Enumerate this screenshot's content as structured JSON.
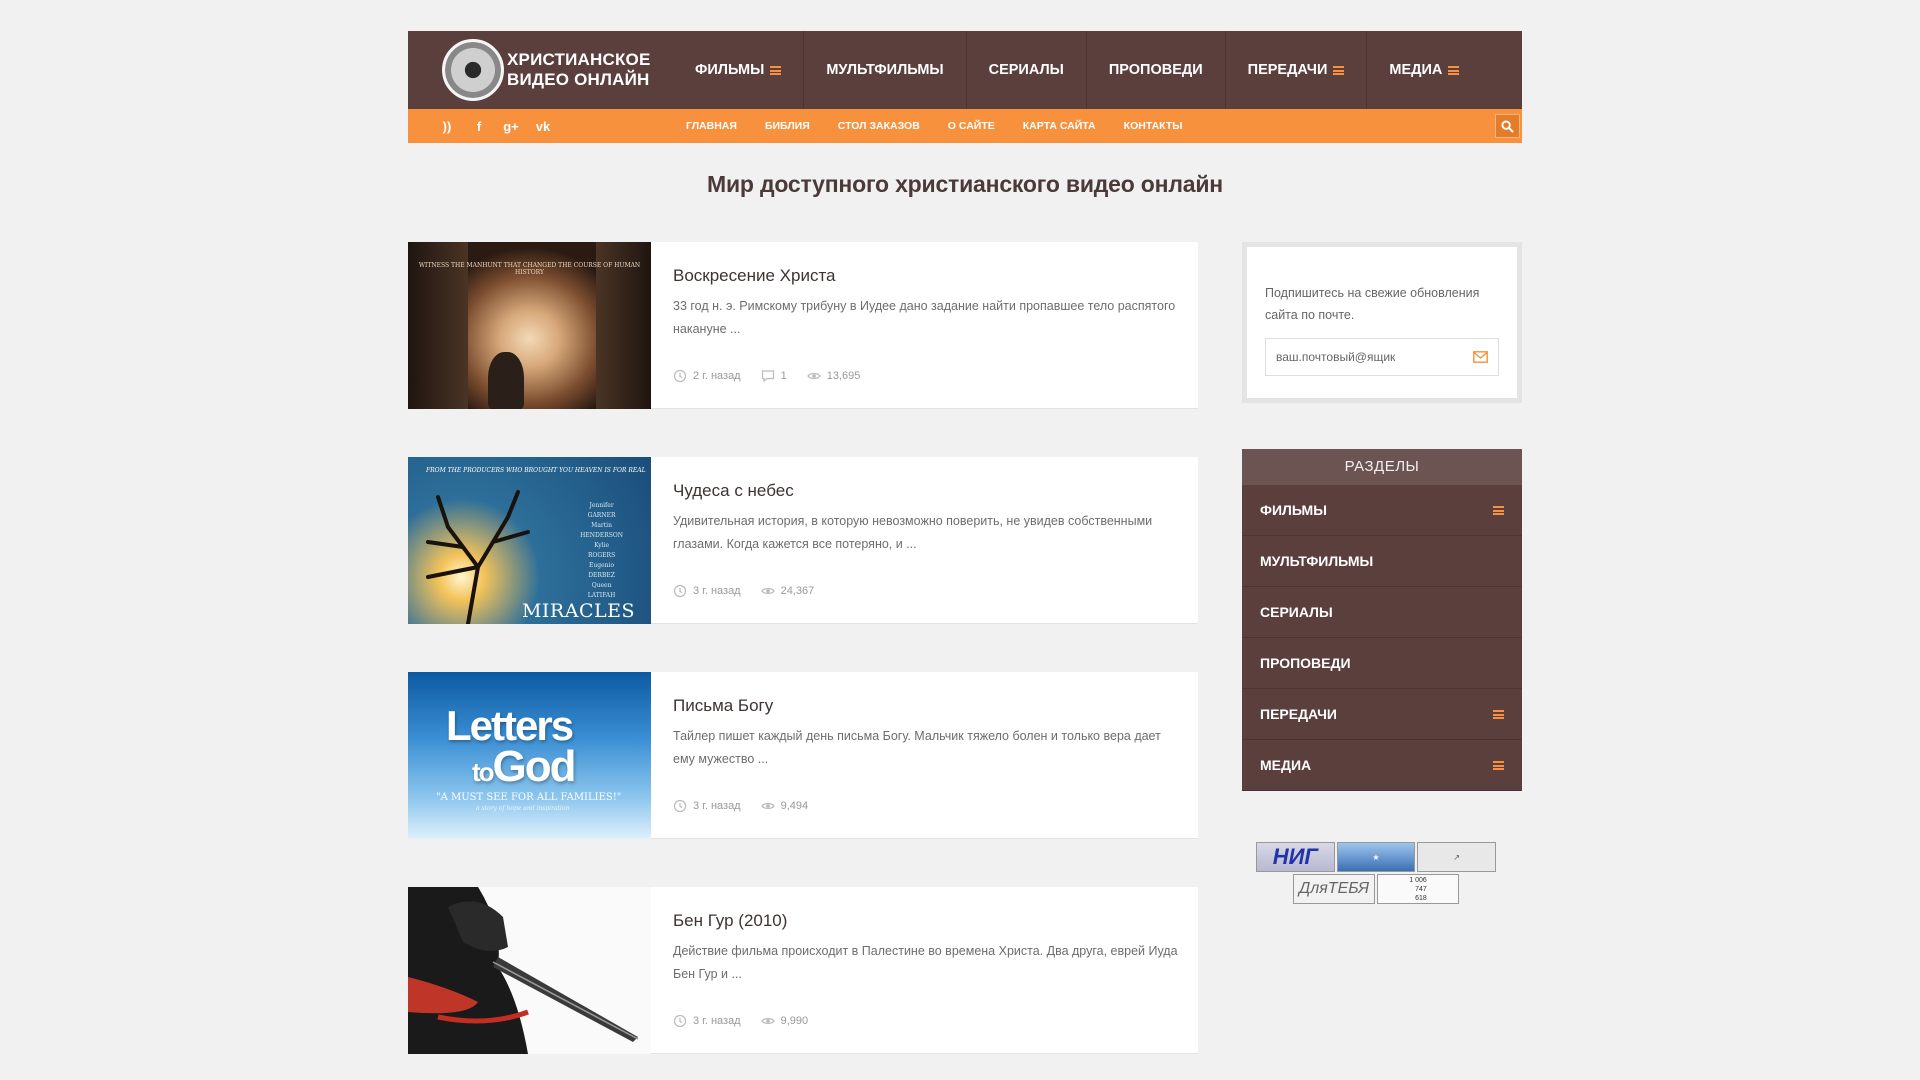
{
  "logo": {
    "line1": "ХРИСТИАНСКОЕ",
    "line2": "ВИДЕО ОНЛАЙН"
  },
  "main_nav": [
    {
      "label": "ФИЛЬМЫ",
      "has_submenu": true
    },
    {
      "label": "МУЛЬТФИЛЬМЫ",
      "has_submenu": false
    },
    {
      "label": "СЕРИАЛЫ",
      "has_submenu": false
    },
    {
      "label": "ПРОПОВЕДИ",
      "has_submenu": false
    },
    {
      "label": "ПЕРЕДАЧИ",
      "has_submenu": true
    },
    {
      "label": "МЕДИА",
      "has_submenu": true
    }
  ],
  "social_icons": [
    "rss-icon",
    "facebook-icon",
    "google-plus-icon",
    "vk-icon"
  ],
  "social_glyphs": [
    "))",
    "f",
    "g+",
    "vk"
  ],
  "sub_nav": [
    "ГЛАВНАЯ",
    "БИБЛИЯ",
    "СТОЛ ЗАКАЗОВ",
    "О САЙТЕ",
    "КАРТА САЙТА",
    "КОНТАКТЫ"
  ],
  "page_title": "Мир доступного христианского видео онлайн",
  "posts": [
    {
      "title": "Воскресение Христа",
      "excerpt": "33 год н. э. Римскому трибуну в Иудее дано задание найти пропавшее тело распятого накануне ...",
      "date": "2 г. назад",
      "comments": "1",
      "views": "13,695",
      "thumb_text": "WITNESS THE MANHUNT THAT CHANGED THE COURSE OF HUMAN HISTORY"
    },
    {
      "title": "Чудеса с небес",
      "excerpt": "Удивительная история, в которую невозможно поверить, не увидев собственными глазами. Когда кажется все потеряно, и ...",
      "date": "3 г. назад",
      "comments": null,
      "views": "24,367",
      "thumb_text": "FROM THE PRODUCERS WHO BROUGHT YOU HEAVEN IS FOR REAL",
      "thumb_title": "MIRACLES"
    },
    {
      "title": "Письма Богу",
      "excerpt": "Тайлер пишет каждый день письма Богу. Мальчик тяжело болен и только вера дает ему мужество ...",
      "date": "3 г. назад",
      "comments": null,
      "views": "9,494",
      "thumb_line1": "Letters",
      "thumb_line2a": "to",
      "thumb_line2b": "God",
      "thumb_tag": "\"A MUST SEE FOR ALL FAMILIES!\"",
      "thumb_tag2": "a story of hope and inspiration"
    },
    {
      "title": "Бен Гур (2010)",
      "excerpt": "Действие фильма происходит в Палестине во времена Христа. Два друга, еврей Иуда Бен Гур и ...",
      "date": "3 г. назад",
      "comments": null,
      "views": "9,990"
    }
  ],
  "subscribe": {
    "text": "Подпишитесь на свежие обновления сайта по почте.",
    "placeholder": "ваш.почтовый@ящик"
  },
  "sections": {
    "title": "РАЗДЕЛЫ",
    "items": [
      {
        "label": "ФИЛЬМЫ",
        "has_submenu": true
      },
      {
        "label": "МУЛЬТФИЛЬМЫ",
        "has_submenu": false
      },
      {
        "label": "СЕРИАЛЫ",
        "has_submenu": false
      },
      {
        "label": "ПРОПОВЕДИ",
        "has_submenu": false
      },
      {
        "label": "ПЕРЕДАЧИ",
        "has_submenu": true
      },
      {
        "label": "МЕДИА",
        "has_submenu": true
      }
    ]
  },
  "counters": {
    "c1": "НИГ",
    "c4": "ДляТЕБЯ",
    "c5a": "1 006",
    "c5b": "747",
    "c5c": "618"
  },
  "colors": {
    "header_bg": "#5a3f3d",
    "accent_orange": "#f7913d",
    "page_bg": "#f1f1f1"
  }
}
